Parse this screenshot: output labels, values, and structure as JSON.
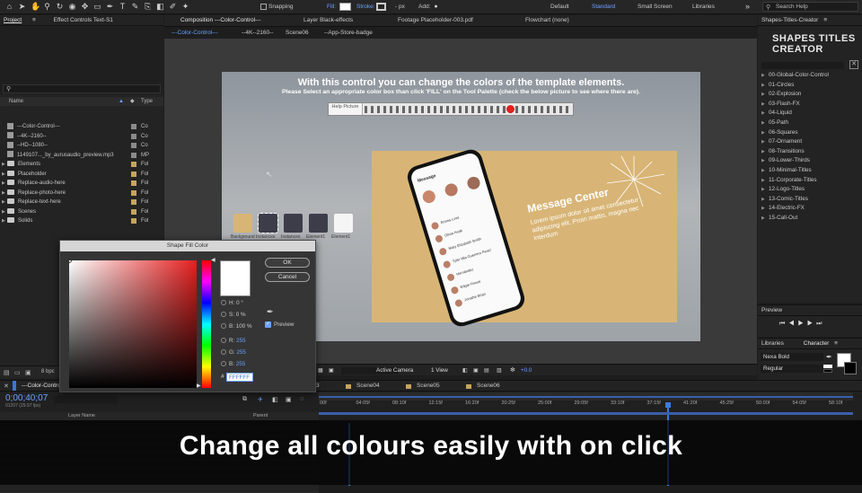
{
  "toolbar": {
    "snapping": "Snapping",
    "fill": "Fill:",
    "stroke": "Stroke:",
    "stroke_units": "- px",
    "add": "Add:",
    "workspaces": [
      "Default",
      "Standard",
      "Small Screen",
      "Libraries"
    ],
    "search_help": "Search Help"
  },
  "project_panel": {
    "title": "Project",
    "effect_controls_tab": "Effect Controls Text-S1",
    "col_name": "Name",
    "col_type": "Type",
    "items": [
      {
        "name": "---Color-Control---",
        "type": "Co",
        "kind": "comp",
        "color": "#8a8a8a"
      },
      {
        "name": "--4K--2160--",
        "type": "Co",
        "kind": "comp",
        "color": "#8a8a8a"
      },
      {
        "name": "--HD--1080--",
        "type": "Co",
        "kind": "comp",
        "color": "#8a8a8a"
      },
      {
        "name": "1149107..._by_aurusaudio_preview.mp3",
        "type": "MP",
        "kind": "file",
        "color": "#8a8a8a"
      },
      {
        "name": "Elements",
        "type": "Fol",
        "kind": "folder",
        "color": "#c7a45b"
      },
      {
        "name": "Placeholder",
        "type": "Fol",
        "kind": "folder",
        "color": "#c7a45b"
      },
      {
        "name": "Replace-audio-here",
        "type": "Fol",
        "kind": "folder",
        "color": "#c7a45b"
      },
      {
        "name": "Replace-photo-here",
        "type": "Fol",
        "kind": "folder",
        "color": "#c7a45b"
      },
      {
        "name": "Replace-text-here",
        "type": "Fol",
        "kind": "folder",
        "color": "#c7a45b"
      },
      {
        "name": "Scenes",
        "type": "Fol",
        "kind": "folder",
        "color": "#c7a45b"
      },
      {
        "name": "Solids",
        "type": "Fol",
        "kind": "folder",
        "color": "#c7a45b"
      }
    ],
    "bpc": "8 bpc"
  },
  "tabs": {
    "composition": "Composition ---Color-Control---",
    "layer": "Layer Black-effects",
    "footage": "Footage Placeholder-003.pdf",
    "flowchart": "Flowchart (none)",
    "breadcrumbs": [
      "---Color-Control---",
      "--4K--2160--",
      "Scene06",
      "--App-Store-badge"
    ]
  },
  "comp": {
    "heading": "With this control you can change the colors of the template elements.",
    "subheading": "Please Select an appropriate color box than click 'FILL' on the Tool Palette (check the below picture to see where there are).",
    "help_picture": "Help Picture",
    "swatches": [
      {
        "label": "Background",
        "color": "#d8b576"
      },
      {
        "label": "Instances",
        "color": "#3d3d4a"
      },
      {
        "label": "Instances",
        "color": "#3d3d4a"
      },
      {
        "label": "Element1",
        "color": "#3d3d4a"
      },
      {
        "label": "Element1",
        "color": "#f5f5f5"
      }
    ],
    "preview_title": "Message Center",
    "preview_body": "Lorem ipsum dolor sit amet consectetur adipiscing elit. Proin mattis, magna nec interdum",
    "phone_app_title": "Message",
    "phone_contacts": [
      "Emma Love",
      "Olivia Hoak",
      "Mary Elizabeth Smith",
      "Tyler Mia Guerrero Perez",
      "Hernández",
      "Edgar House",
      "Jonathe Brian"
    ]
  },
  "viewer_bar": {
    "camera": "Active Camera",
    "view": "1 View",
    "exposure": "+0.0"
  },
  "color_dialog": {
    "title": "Shape Fill Color",
    "ok": "OK",
    "cancel": "Cancel",
    "h_label": "H:",
    "h_value": "0 °",
    "s_label": "S:",
    "s_value": "0 %",
    "b_label": "B:",
    "b_value": "100 %",
    "r_label": "R:",
    "r_value": "255",
    "g_label": "G:",
    "g_value": "255",
    "bb_label": "B:",
    "bb_value": "255",
    "hex_value": "FFFFFF",
    "preview_label": "Preview"
  },
  "right_panel": {
    "title": "Shapes-Titles-Creator",
    "logo_line1": "SHAPES TITLES",
    "logo_line2": "CREATOR",
    "items": [
      "00-Global-Color-Control",
      "01-Circles",
      "02-Explosion",
      "03-Flash-FX",
      "04-Liquid",
      "05-Path",
      "06-Squares",
      "07-Ornament",
      "08-Transitions",
      "09-Lower-Thirds",
      "10-Minimal-Titles",
      "11-Corporate-Titles",
      "12-Logo-Titles",
      "13-Comic-Titles",
      "14-Electric-FX",
      "15-Call-Out"
    ],
    "preview": "Preview",
    "libraries": "Libraries",
    "character": "Character",
    "font": "Nexa Bold",
    "style": "Regular"
  },
  "timeline": {
    "comp_tab": "---Color-Control---",
    "timecode": "0;00;40;07",
    "frames": "01207 (29.97 fps)",
    "scene_tabs": [
      "Scene04",
      "Scene05",
      "Scene06"
    ],
    "ticks": [
      "00f",
      "04:05f",
      "08:10f",
      "12:15f",
      "16:20f",
      "20:25f",
      "25:00f",
      "29:05f",
      "33:10f",
      "37:15f",
      "41:20f",
      "45:25f",
      "50:00f",
      "54:05f",
      "58:10f"
    ],
    "layer_col": "Layer Name",
    "parent_col": "Parent"
  },
  "caption": "Change all colours easily with on click"
}
